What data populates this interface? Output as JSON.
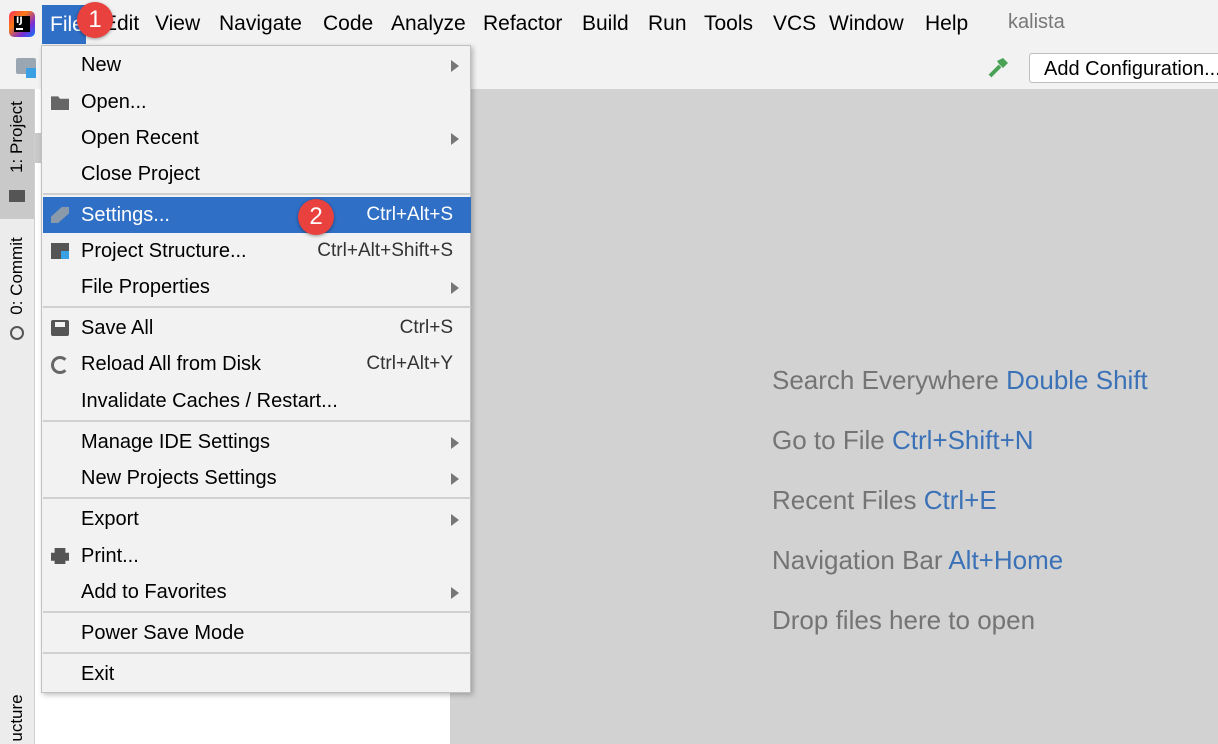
{
  "menubar": {
    "items": [
      {
        "label": "File",
        "u": 0
      },
      {
        "label": "Edit",
        "u": 0
      },
      {
        "label": "View",
        "u": 0
      },
      {
        "label": "Navigate",
        "u": 0
      },
      {
        "label": "Code",
        "u": 0
      },
      {
        "label": "Analyze",
        "u": -1
      },
      {
        "label": "Refactor",
        "u": 0
      },
      {
        "label": "Build",
        "u": 0
      },
      {
        "label": "Run",
        "u": 1
      },
      {
        "label": "Tools",
        "u": 0
      },
      {
        "label": "VCS",
        "u": -1
      },
      {
        "label": "Window",
        "u": 0
      },
      {
        "label": "Help",
        "u": 0
      }
    ],
    "project_name": "kalista"
  },
  "toolbar": {
    "add_configuration": "Add Configuration..."
  },
  "left_tabs": {
    "project": "1: Project",
    "commit": "0: Commit",
    "structure": "ucture"
  },
  "file_menu": {
    "items": [
      {
        "label": "New",
        "shortcut": "",
        "submenu": true
      },
      {
        "label": "Open...",
        "shortcut": "",
        "submenu": false
      },
      {
        "label": "Open Recent",
        "shortcut": "",
        "submenu": true
      },
      {
        "label": "Close Project",
        "shortcut": "",
        "submenu": false
      },
      {
        "label": "Settings...",
        "shortcut": "Ctrl+Alt+S",
        "submenu": false
      },
      {
        "label": "Project Structure...",
        "shortcut": "Ctrl+Alt+Shift+S",
        "submenu": false
      },
      {
        "label": "File Properties",
        "shortcut": "",
        "submenu": true
      },
      {
        "label": "Save All",
        "shortcut": "Ctrl+S",
        "submenu": false
      },
      {
        "label": "Reload All from Disk",
        "shortcut": "Ctrl+Alt+Y",
        "submenu": false
      },
      {
        "label": "Invalidate Caches / Restart...",
        "shortcut": "",
        "submenu": false
      },
      {
        "label": "Manage IDE Settings",
        "shortcut": "",
        "submenu": true
      },
      {
        "label": "New Projects Settings",
        "shortcut": "",
        "submenu": true
      },
      {
        "label": "Export",
        "shortcut": "",
        "submenu": true
      },
      {
        "label": "Print...",
        "shortcut": "",
        "submenu": false
      },
      {
        "label": "Add to Favorites",
        "shortcut": "",
        "submenu": true
      },
      {
        "label": "Power Save Mode",
        "shortcut": "",
        "submenu": false
      },
      {
        "label": "Exit",
        "shortcut": "",
        "submenu": false
      }
    ]
  },
  "editor_hints": [
    {
      "text": "Search Everywhere",
      "key": "Double Shift"
    },
    {
      "text": "Go to File",
      "key": "Ctrl+Shift+N"
    },
    {
      "text": "Recent Files",
      "key": "Ctrl+E"
    },
    {
      "text": "Navigation Bar",
      "key": "Alt+Home"
    },
    {
      "text": "Drop files here to open",
      "key": ""
    }
  ],
  "badges": [
    "1",
    "2"
  ],
  "colors": {
    "selection": "#2f6fc6",
    "badge": "#e8413e",
    "hint_key": "#3b72b7"
  }
}
